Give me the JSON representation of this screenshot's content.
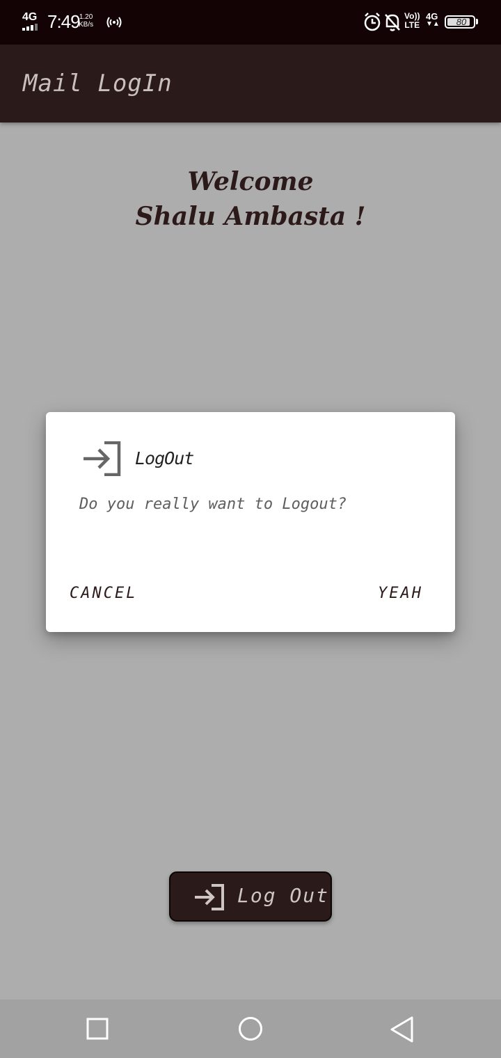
{
  "status_bar": {
    "network": "4G",
    "time": "7:49",
    "speed_value": "1.20",
    "speed_unit": "KB/s",
    "volte_top": "Vo))",
    "volte_bottom": "LTE",
    "network_right": "4G",
    "battery": "80",
    "icons": [
      "signal-icon",
      "hotspot-icon",
      "alarm-icon",
      "notifications-off-icon",
      "battery-icon"
    ]
  },
  "app_bar": {
    "title": "Mail LogIn"
  },
  "main": {
    "welcome_line1": "Welcome",
    "welcome_line2": "Shalu Ambasta !",
    "logout_button_label": "Log Out",
    "logout_icon": "login-arrow-icon"
  },
  "dialog": {
    "icon": "login-arrow-icon",
    "title": "LogOut",
    "message": "Do you really want to Logout?",
    "cancel_label": "CANCEL",
    "confirm_label": "YEAH"
  },
  "nav_bar": {
    "icons": [
      "recent-apps-icon",
      "home-icon",
      "back-icon"
    ]
  },
  "colors": {
    "app_bar": "#2a1b1a",
    "status_bar": "#130304",
    "scrim_background": "#adadad",
    "accent_text": "#2b1a19"
  }
}
